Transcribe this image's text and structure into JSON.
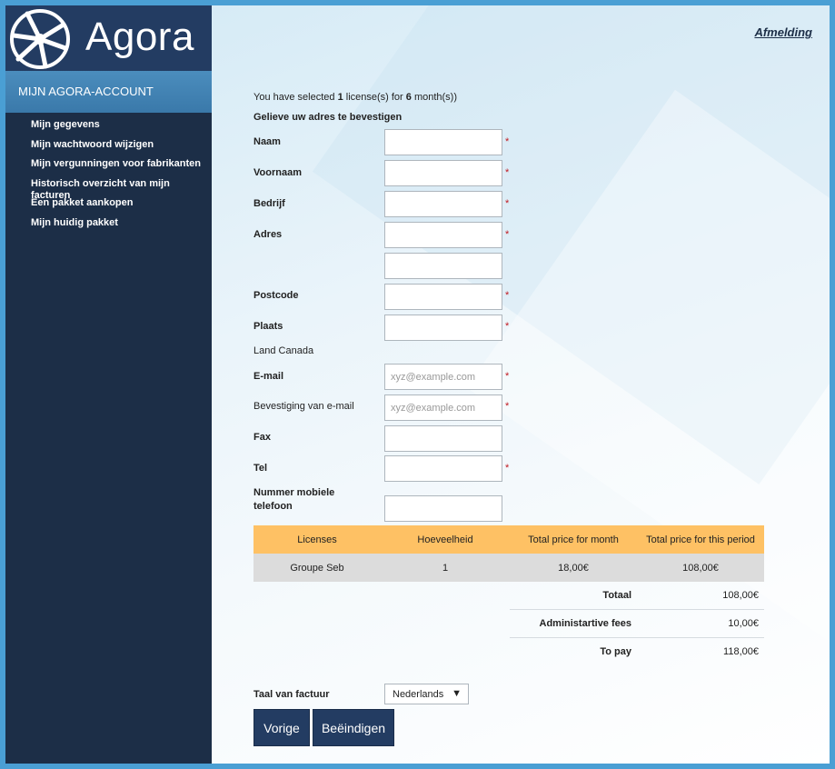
{
  "brand": {
    "name": "Agora"
  },
  "sidebar": {
    "header": "MIJN AGORA-ACCOUNT",
    "items": [
      "Mijn gegevens",
      "Mijn wachtwoord wijzigen",
      "Mijn vergunningen voor fabrikanten",
      "Historisch overzicht van mijn facturen",
      "Een pakket aankopen",
      "Mijn huidig pakket"
    ]
  },
  "header": {
    "logout": "Afmelding"
  },
  "selection": {
    "prefix": "You have selected ",
    "licenses": "1",
    "middle": " license(s) for ",
    "months": "6",
    "suffix": " month(s))"
  },
  "form": {
    "title": "Gelieve uw adres te bevestigen",
    "naam_label": "Naam",
    "voornaam_label": "Voornaam",
    "bedrijf_label": "Bedrijf",
    "adres_label": "Adres",
    "postcode_label": "Postcode",
    "plaats_label": "Plaats",
    "land_text": "Land Canada",
    "email_label": "E-mail",
    "email_placeholder": "xyz@example.com",
    "email_confirm_label": "Bevestiging van e-mail",
    "email_confirm_placeholder": "xyz@example.com",
    "fax_label": "Fax",
    "tel_label": "Tel",
    "mobile_label": "Nummer mobiele telefoon",
    "required_mark": "*"
  },
  "table": {
    "headers": [
      "Licenses",
      "Hoeveelheid",
      "Total price for month",
      "Total price for this period"
    ],
    "rows": [
      [
        "Groupe Seb",
        "1",
        "18,00€",
        "108,00€"
      ]
    ]
  },
  "summary": {
    "total_label": "Totaal",
    "total_value": "108,00€",
    "fees_label": "Administartive fees",
    "fees_value": "10,00€",
    "pay_label": "To pay",
    "pay_value": "118,00€"
  },
  "invoice_language": {
    "label": "Taal van factuur",
    "selected": "Nederlands"
  },
  "buttons": {
    "previous": "Vorige",
    "finish": "Beëindigen"
  },
  "colors": {
    "sidebar": "#1c2e47",
    "accent": "#fec164",
    "required": "#c0181f",
    "button": "#233c62"
  }
}
